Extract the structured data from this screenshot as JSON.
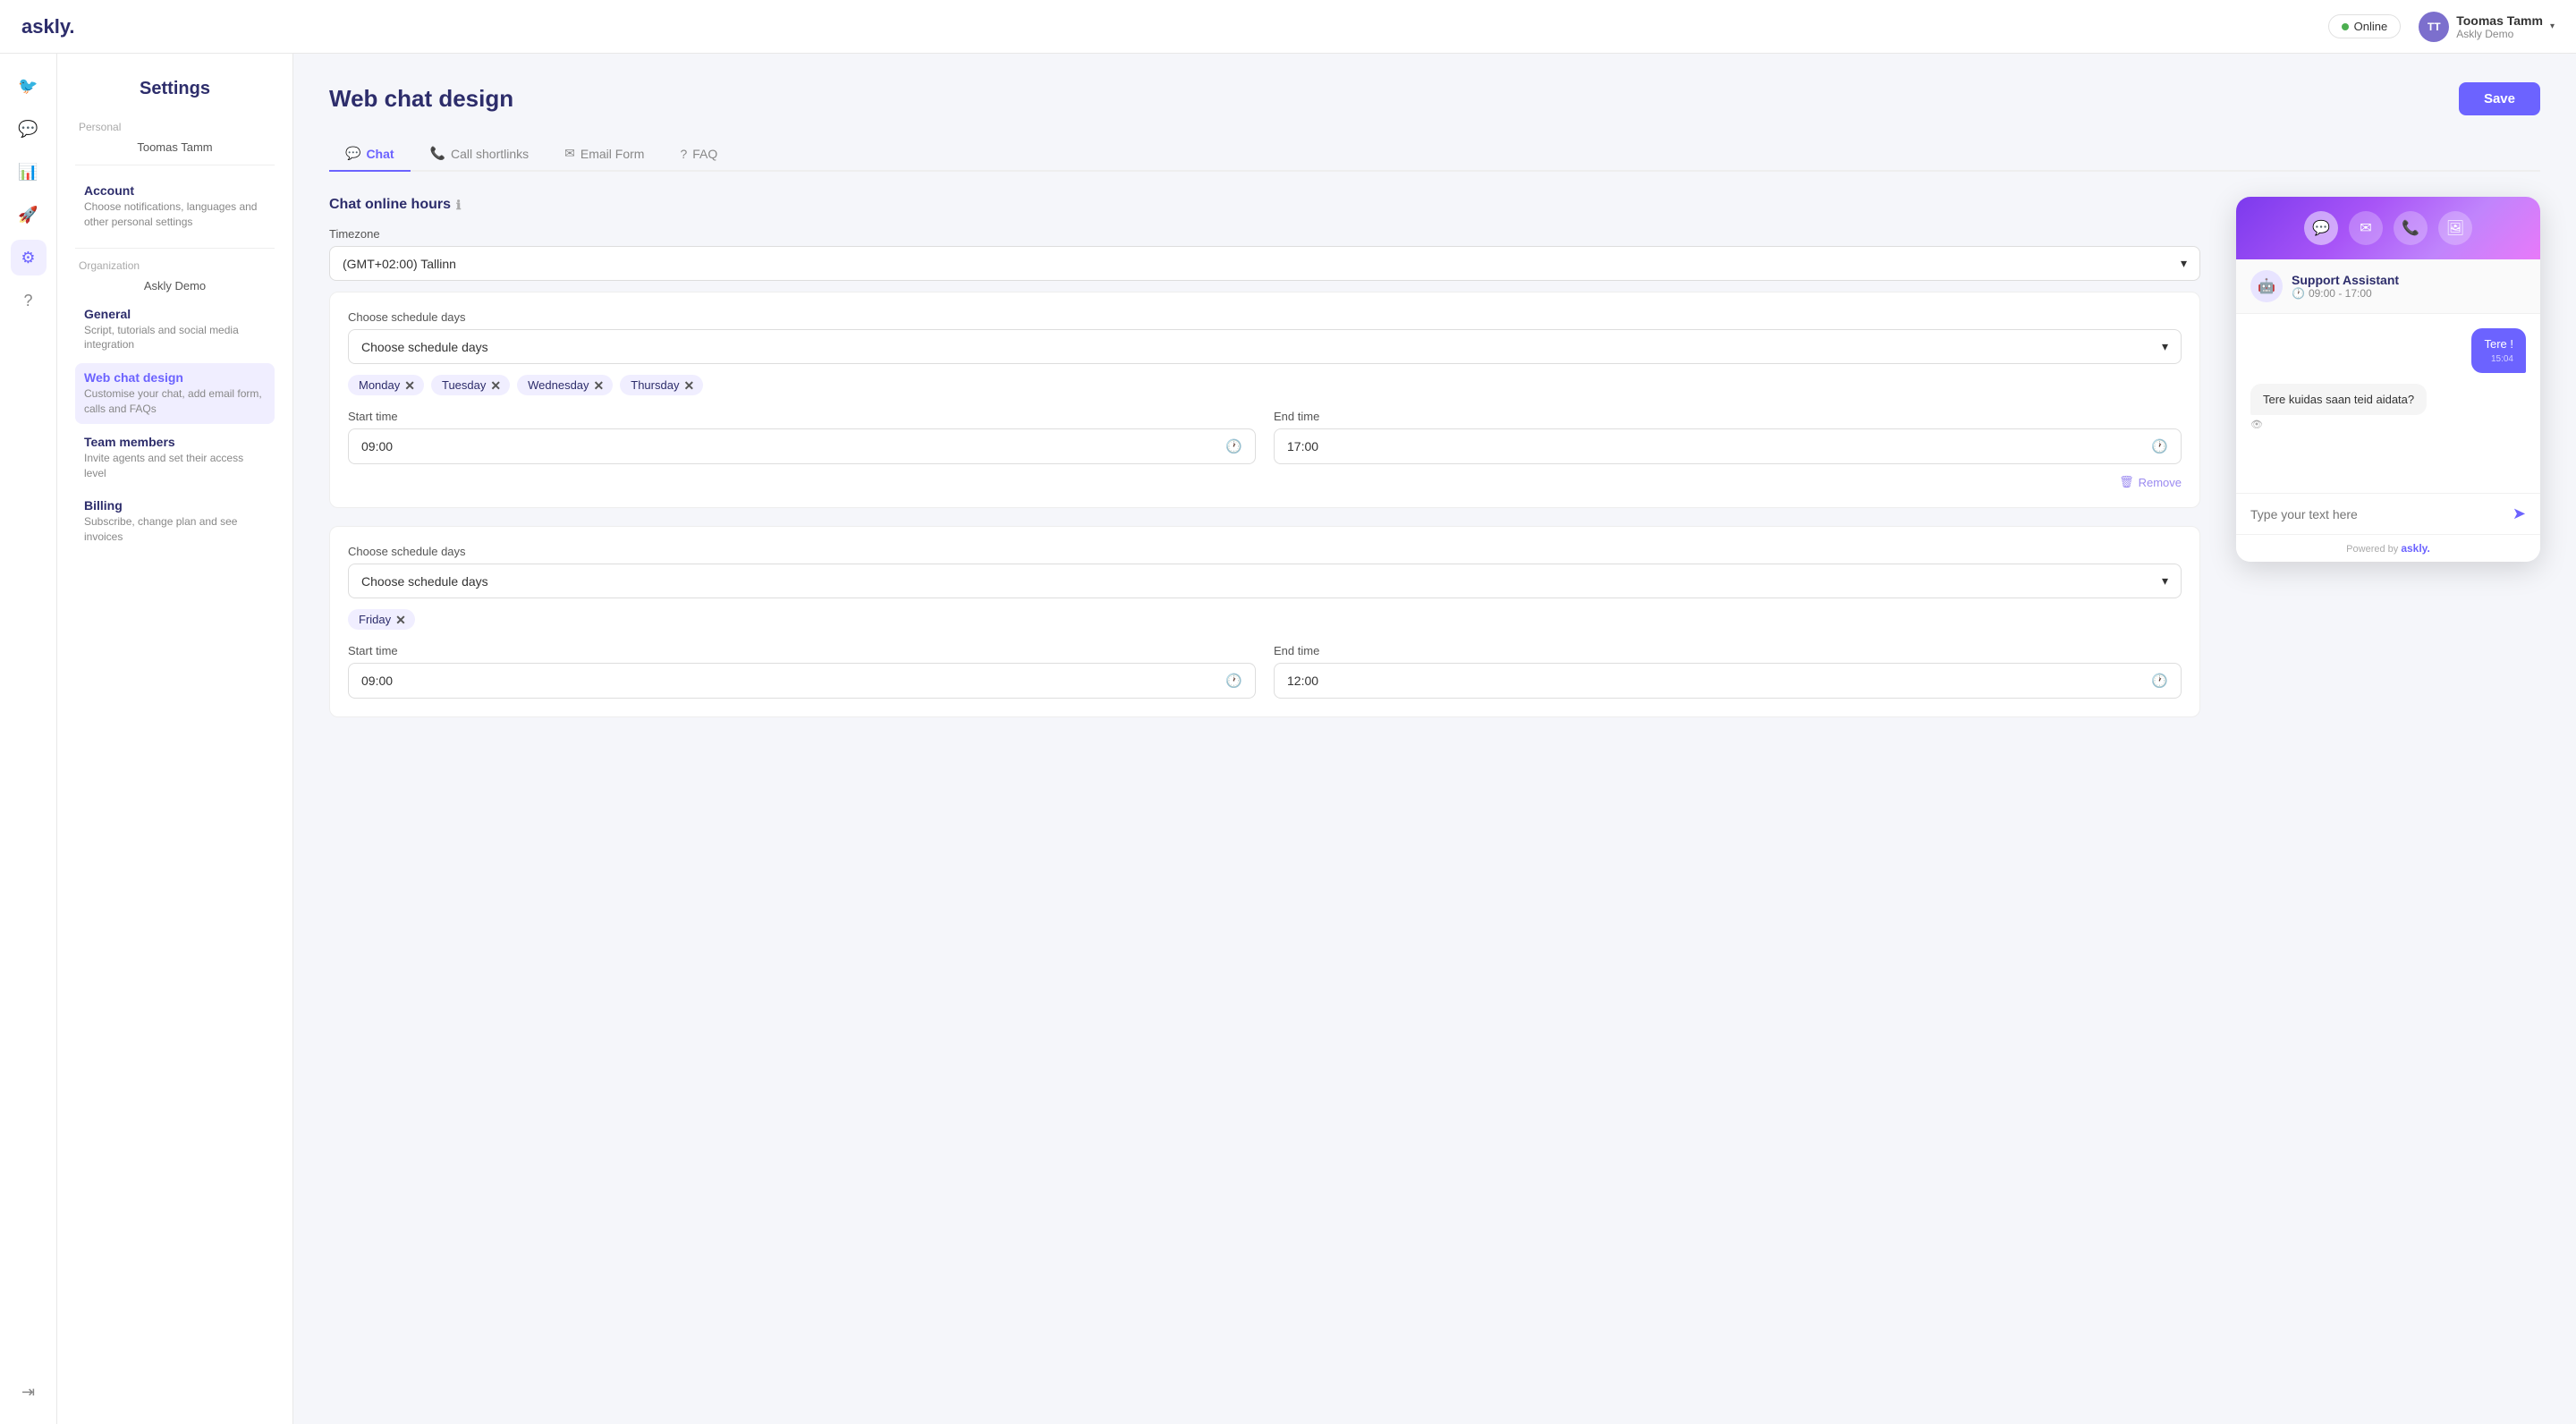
{
  "app": {
    "logo": "askly.",
    "status": {
      "label": "Online",
      "dot_color": "#4caf50"
    },
    "user": {
      "name": "Toomas Tamm",
      "org": "Askly Demo",
      "initials": "TT"
    }
  },
  "icon_sidebar": {
    "icons": [
      {
        "name": "chat-bubble-icon",
        "symbol": "💬"
      },
      {
        "name": "message-icon",
        "symbol": "🗨"
      },
      {
        "name": "chart-icon",
        "symbol": "📊"
      },
      {
        "name": "rocket-icon",
        "symbol": "🚀"
      },
      {
        "name": "gear-icon",
        "symbol": "⚙",
        "active": true
      },
      {
        "name": "help-icon",
        "symbol": "?"
      }
    ],
    "bottom": [
      {
        "name": "logout-icon",
        "symbol": "→"
      }
    ]
  },
  "settings_sidebar": {
    "title": "Settings",
    "personal_label": "Personal",
    "personal_name": "Toomas Tamm",
    "sections": [
      {
        "group": "personal",
        "items": [
          {
            "title": "Account",
            "sub": "Choose notifications, languages and other personal settings",
            "active": false
          }
        ]
      },
      {
        "group": "organization",
        "label": "Organization",
        "org_name": "Askly Demo",
        "items": [
          {
            "title": "General",
            "sub": "Script, tutorials and social media integration",
            "active": false
          },
          {
            "title": "Web chat design",
            "sub": "Customise your chat, add email form, calls and FAQs",
            "active": true
          },
          {
            "title": "Team members",
            "sub": "Invite agents and set their access level",
            "active": false
          },
          {
            "title": "Billing",
            "sub": "Subscribe, change plan and see invoices",
            "active": false
          }
        ]
      }
    ]
  },
  "page": {
    "title": "Web chat design",
    "save_button": "Save",
    "tabs": [
      {
        "label": "Chat",
        "icon": "💬",
        "active": true
      },
      {
        "label": "Call shortlinks",
        "icon": "📞"
      },
      {
        "label": "Email Form",
        "icon": "✉"
      },
      {
        "label": "FAQ",
        "icon": "?"
      }
    ],
    "chat_online_hours": {
      "heading": "Chat online hours",
      "timezone_label": "Timezone",
      "timezone_value": "(GMT+02:00) Tallinn",
      "schedule1": {
        "choose_label": "Choose schedule days",
        "placeholder": "Choose schedule days",
        "days": [
          "Monday",
          "Tuesday",
          "Wednesday",
          "Thursday"
        ],
        "start_time_label": "Start time",
        "start_time": "09:00",
        "end_time_label": "End time",
        "end_time": "17:00",
        "remove_label": "Remove"
      },
      "schedule2": {
        "choose_label": "Choose schedule days",
        "placeholder": "Choose schedule days",
        "days": [
          "Friday"
        ],
        "start_time_label": "Start time",
        "start_time": "09:00",
        "end_time_label": "End time",
        "end_time": "12:00"
      }
    }
  },
  "chat_preview": {
    "tabs": [
      {
        "icon": "💬",
        "active": true
      },
      {
        "icon": "✉"
      },
      {
        "icon": "📞"
      },
      {
        "icon": "🖼"
      }
    ],
    "agent_name": "Support Assistant",
    "agent_hours": "09:00 - 17:00",
    "messages": [
      {
        "type": "right",
        "text": "Tere !",
        "time": "15:04"
      },
      {
        "type": "left",
        "text": "Tere kuidas saan teid aidata?"
      }
    ],
    "input_placeholder": "Type your text here",
    "powered_by_label": "Powered by",
    "powered_by_brand": "askly."
  }
}
